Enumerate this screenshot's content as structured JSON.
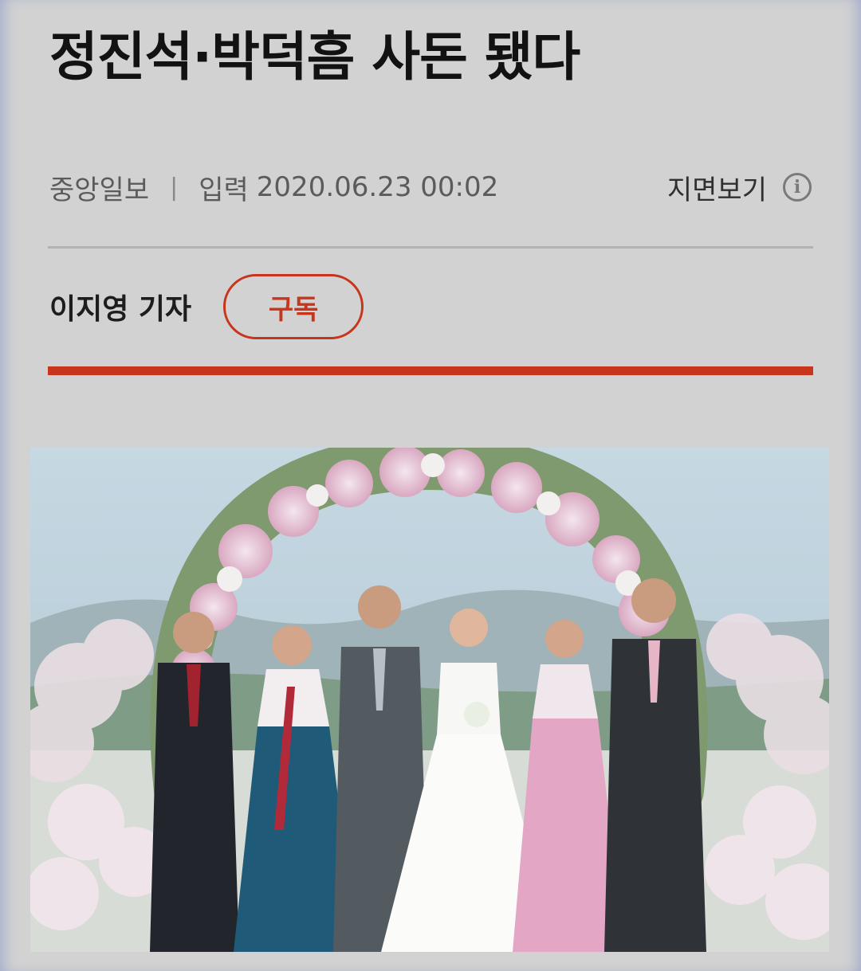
{
  "article": {
    "headline": "정진석·박덕흠 사돈 됐다",
    "publisher": "중앙일보",
    "separator": "|",
    "input_label": "입력",
    "datetime": "2020.06.23 00:02",
    "print_view_label": "지면보기",
    "reporter": "이지영 기자",
    "subscribe_label": "구독"
  },
  "colors": {
    "accent": "#c8351d",
    "background": "#d2d2d2",
    "headline_text": "#121212"
  },
  "icons": {
    "info": "info-circle-icon"
  }
}
